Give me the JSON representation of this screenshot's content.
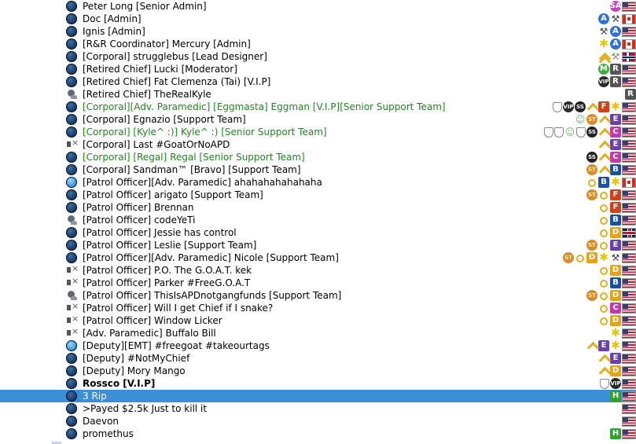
{
  "badge_legend": {
    "sa": "SA",
    "a": "A",
    "m": "M",
    "r": "R",
    "f": "F",
    "e": "E",
    "c": "C",
    "b": "B",
    "d": "D",
    "h": "H",
    "st": "ST",
    "ss": "SS",
    "vip": "VIP"
  },
  "colors": {
    "selected_row": "#3a8fd6",
    "green_name": "#1b8a1b",
    "badge_a": "#2f6fd6",
    "badge_m": "#3fae3f",
    "badge_r": "#555555",
    "badge_f": "#d0421b",
    "badge_e": "#6a3fb0",
    "badge_c": "#c23aa8",
    "badge_b": "#1d4f9c",
    "badge_d": "#e6a21a",
    "badge_h": "#2ea32e",
    "badge_st": "#d98a2a",
    "badge_sa": "#c247b8"
  },
  "users": [
    {
      "name": "Peter Long [Senior Admin]",
      "status": "normal",
      "badges": [
        "sa",
        "flag-us"
      ]
    },
    {
      "name": "Doc [Admin]",
      "status": "normal",
      "badges": [
        "a",
        "wrench",
        "flag-ca"
      ]
    },
    {
      "name": "Ignis [Admin]",
      "status": "normal",
      "badges": [
        "wrench",
        "a",
        "flag-us"
      ]
    },
    {
      "name": "[R&R Coordinator] Mercury [Admin]",
      "status": "normal",
      "badges": [
        "star",
        "a",
        "flag-ca"
      ]
    },
    {
      "name": "[Corporal] strugglebus [Lead Designer]",
      "status": "normal",
      "badges": [
        "chev2",
        "hammer",
        "flag-no"
      ]
    },
    {
      "name": "[Retired Chief] Lucki [Moderator]",
      "status": "normal",
      "badges": [
        "m",
        "r",
        "flag-us"
      ]
    },
    {
      "name": "[Retired Chief] Fat Clemenza (Tai) [V.I.P]",
      "status": "normal",
      "badges": [
        "vip",
        "r",
        "flag-us"
      ]
    },
    {
      "name": "[Retired Chief] TheRealKyle",
      "status": "away",
      "badges": [
        "r"
      ]
    },
    {
      "name": "[Corporal][Adv. Paramedic] [Eggmasta] Eggman [V.I.P][Senior Support Team]",
      "status": "normal",
      "green": true,
      "badges": [
        "shield",
        "vip",
        "ss",
        "chev1",
        "f",
        "star",
        "flag-us"
      ]
    },
    {
      "name": "[Corporal] Egnazio [Support Team]",
      "status": "normal",
      "badges": [
        "person",
        "st",
        "chev1",
        "e",
        "flag-us"
      ]
    },
    {
      "name": "[Corporal] [Kyle^ :)] Kyle^ :) [Senior Support Team]",
      "status": "normal",
      "green": true,
      "badges": [
        "shield",
        "shield",
        "person",
        "shield",
        "ss",
        "chev1",
        "c",
        "flag-us"
      ]
    },
    {
      "name": "[Corporal] Last #GoatOrNoAPD",
      "status": "muted",
      "badges": [
        "chev1",
        "e",
        "flag-us"
      ]
    },
    {
      "name": "[Corporal] [Regal] Regal [Senior Support Team]",
      "status": "normal",
      "green": true,
      "badges": [
        "ss",
        "chev1",
        "c",
        "flag-us"
      ]
    },
    {
      "name": "[Corporal] Sandman™ [Bravo] [Support Team]",
      "status": "normal",
      "badges": [
        "st",
        "chev1",
        "b",
        "flag-us"
      ]
    },
    {
      "name": "[Patrol Officer][Adv. Paramedic] ahahahahahahaha",
      "status": "active",
      "badges": [
        "medal",
        "b",
        "star",
        "flag-ca"
      ]
    },
    {
      "name": "[Patrol Officer] arigato [Support Team]",
      "status": "normal",
      "badges": [
        "st",
        "medal",
        "f",
        "flag-us"
      ]
    },
    {
      "name": "[Patrol Officer] Brennan",
      "status": "normal",
      "badges": [
        "medal",
        "f",
        "flag-us"
      ]
    },
    {
      "name": "[Patrol Officer] codeYeTi",
      "status": "away",
      "badges": [
        "medal",
        "b",
        "flag-us"
      ]
    },
    {
      "name": "[Patrol Officer] Jessie has control",
      "status": "normal",
      "badges": [
        "medal",
        "d",
        "flag-gb"
      ]
    },
    {
      "name": "[Patrol Officer] Leslie [Support Team]",
      "status": "normal",
      "badges": [
        "st",
        "medal",
        "e",
        "flag-us"
      ]
    },
    {
      "name": "[Patrol Officer][Adv. Paramedic] Nicole [Support Team]",
      "status": "normal",
      "badges": [
        "st",
        "medal",
        "d",
        "star",
        "wrench",
        "flag-us"
      ]
    },
    {
      "name": "[Patrol Officer] P.O. The G.O.A.T. kek",
      "status": "muted",
      "badges": [
        "medal",
        "d",
        "flag-us"
      ]
    },
    {
      "name": "[Patrol Officer] Parker #FreeG.O.A.T",
      "status": "muted",
      "badges": [
        "medal",
        "b",
        "flag-us"
      ]
    },
    {
      "name": "[Patrol Officer] ThisIsAPDnotgangfunds [Support Team]",
      "status": "away",
      "badges": [
        "st",
        "medal",
        "d",
        "flag-us"
      ]
    },
    {
      "name": "[Patrol Officer] Will I get Chief if I snake?",
      "status": "muted",
      "badges": [
        "medal",
        "c",
        "flag-us"
      ]
    },
    {
      "name": "[Patrol Officer] Window Licker",
      "status": "muted",
      "badges": [
        "medal",
        "d",
        "flag-us"
      ]
    },
    {
      "name": "[Adv. Paramedic] Buffalo Bill",
      "status": "muted",
      "badges": [
        "star",
        "flag-us"
      ]
    },
    {
      "name": "[Deputy][EMT] #freegoat #takeourtags",
      "status": "active",
      "badges": [
        "chev1",
        "e",
        "star",
        "flag-us"
      ]
    },
    {
      "name": "[Deputy] #NotMyChief",
      "status": "normal",
      "badges": [
        "chev1",
        "e",
        "flag-us"
      ]
    },
    {
      "name": "[Deputy] Mory Mango",
      "status": "normal",
      "badges": [
        "chev1",
        "d",
        "flag-us"
      ]
    },
    {
      "name": "Rossco [V.I.P]",
      "status": "normal",
      "bold": true,
      "badges": [
        "shield",
        "vip",
        "flag-us"
      ]
    },
    {
      "name": "3 Rip",
      "status": "normal",
      "selected": true,
      "badges": [
        "h",
        "flag-us"
      ]
    },
    {
      "name": ">Payed $2.5k Just to kill it",
      "status": "normal",
      "badges": [
        "flag-us"
      ]
    },
    {
      "name": "Daevon",
      "status": "normal",
      "badges": [
        "flag-us"
      ]
    },
    {
      "name": "promethus",
      "status": "normal",
      "badges": [
        "h",
        "flag-us"
      ]
    }
  ]
}
